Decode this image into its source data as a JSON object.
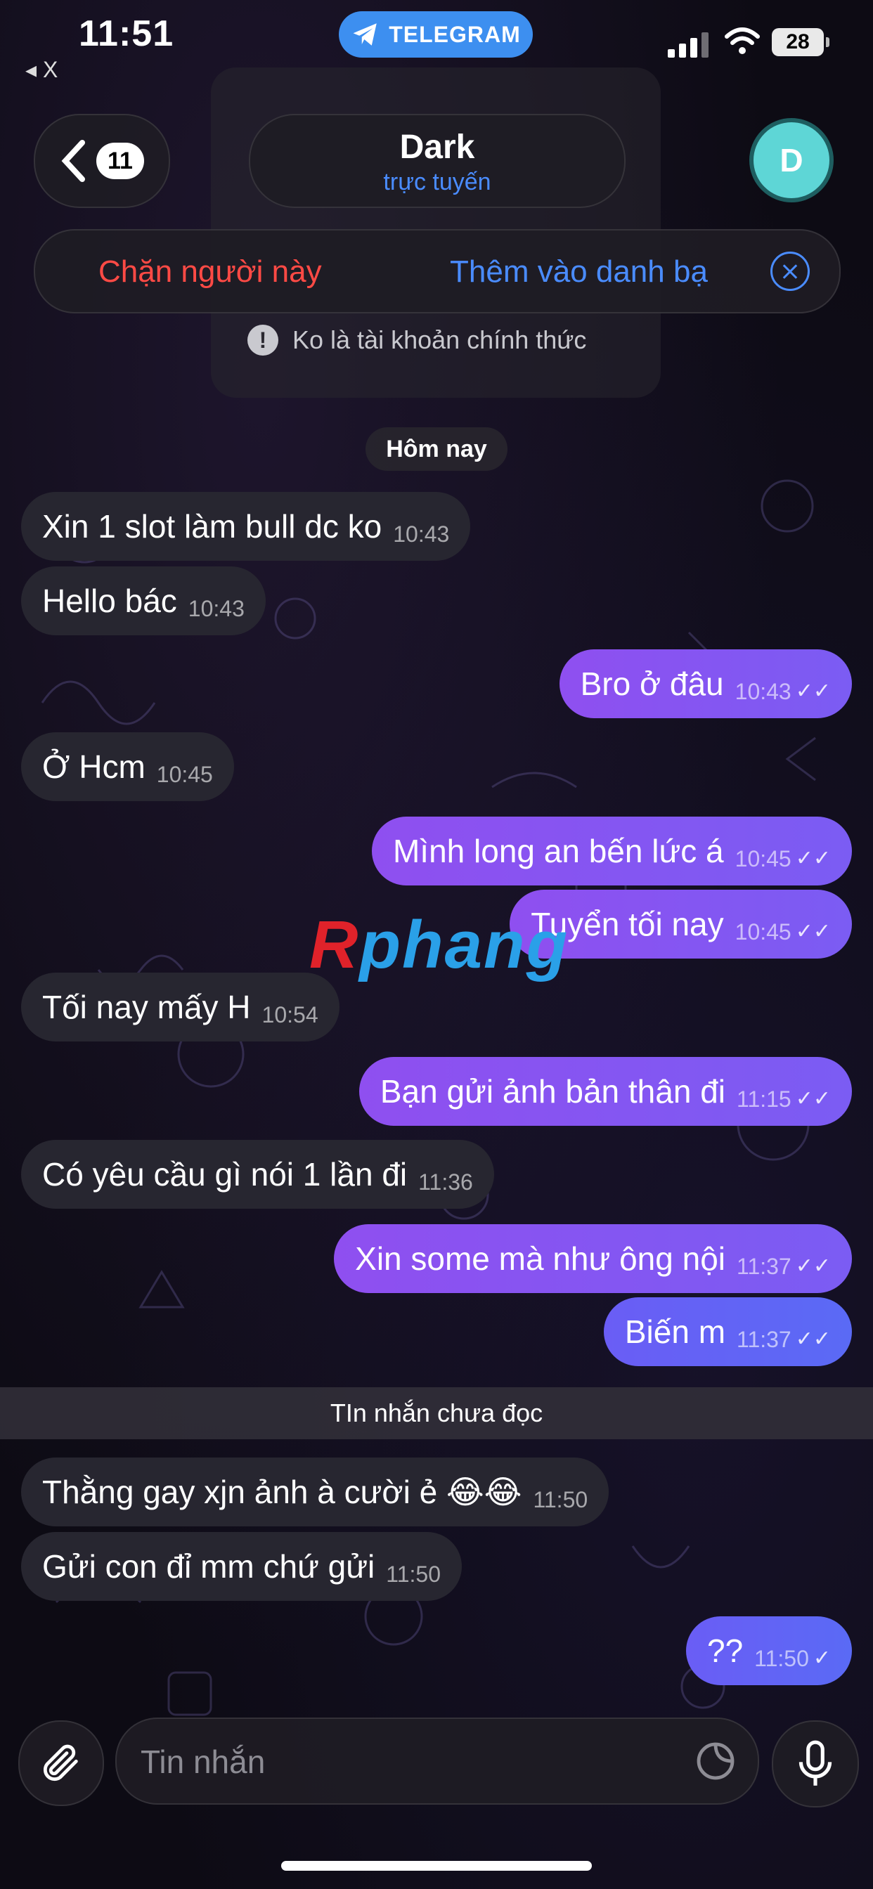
{
  "status_bar": {
    "time": "11:51",
    "back_app": "◂ X",
    "app_pill": "TELEGRAM",
    "battery": "28"
  },
  "header": {
    "unread_count": "11",
    "title": "Dark",
    "subtitle": "trực tuyến",
    "avatar_letter": "D"
  },
  "action_bar": {
    "block_label": "Chặn người này",
    "add_label": "Thêm vào danh bạ"
  },
  "info_note": "Ko là tài khoản chính thức",
  "date_separator": "Hôm nay",
  "messages": [
    {
      "dir": "in",
      "text": "Xin 1 slot làm bull dc ko",
      "time": "10:43"
    },
    {
      "dir": "in",
      "text": "Hello bác",
      "time": "10:43"
    },
    {
      "dir": "out",
      "text": "Bro ở đâu",
      "time": "10:43",
      "check": "✓✓"
    },
    {
      "dir": "in",
      "text": "Ở Hcm",
      "time": "10:45"
    },
    {
      "dir": "out",
      "text": "Mình long an bến lức á",
      "time": "10:45",
      "check": "✓✓"
    },
    {
      "dir": "out",
      "text": "Tuyển tối nay",
      "time": "10:45",
      "check": "✓✓"
    },
    {
      "dir": "in",
      "text": "Tối nay mấy H",
      "time": "10:54"
    },
    {
      "dir": "out",
      "text": "Bạn gửi ảnh bản thân đi",
      "time": "11:15",
      "check": "✓✓"
    },
    {
      "dir": "in",
      "text": "Có yêu cầu gì nói 1 lần đi",
      "time": "11:36"
    },
    {
      "dir": "out",
      "text": "Xin some mà như ông nội",
      "time": "11:37",
      "check": "✓✓"
    },
    {
      "dir": "out",
      "text": "Biến m",
      "time": "11:37",
      "check": "✓✓"
    },
    {
      "dir": "in",
      "text": "Thằng gay xjn ảnh à cười ẻ 😂😂",
      "time": "11:50"
    },
    {
      "dir": "in",
      "text": "Gửi con đỉ mm chứ gửi",
      "time": "11:50"
    },
    {
      "dir": "out",
      "text": "??",
      "time": "11:50",
      "check": "✓"
    }
  ],
  "unread_separator": "TIn nhắn chưa đọc",
  "watermark": {
    "part1": "R",
    "part2": "phang"
  },
  "composer": {
    "placeholder": "Tin nhắn"
  },
  "colors": {
    "accent": "#4a8cff",
    "danger": "#ff4a45",
    "outgoing": "#8f4ff0",
    "incoming": "#272630"
  }
}
